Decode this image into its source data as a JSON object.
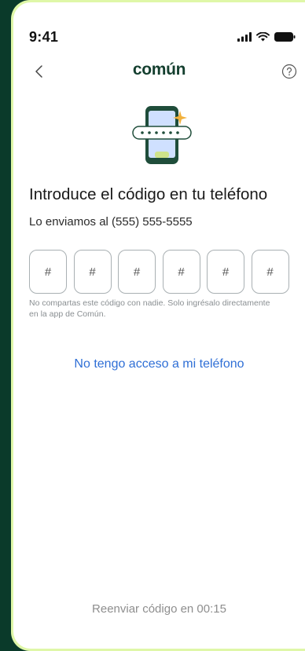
{
  "status_bar": {
    "time": "9:41",
    "icons": [
      "signal-icon",
      "wifi-icon",
      "battery-icon"
    ]
  },
  "nav": {
    "back_icon": "chevron-left-icon",
    "logo": "común",
    "help_icon": "question-circle-icon"
  },
  "illustration": {
    "icon": "phone-code-illustration",
    "colors": {
      "phone": "#1f4d3a",
      "screen": "#cfe0ff",
      "code_bar": "#ffffff",
      "sparkle": "#f2b13c",
      "button": "#cfe38a"
    }
  },
  "content": {
    "title": "Introduce el código en tu teléfono",
    "subtitle": "Lo enviamos al (555) 555-5555",
    "code_fields": [
      "#",
      "#",
      "#",
      "#",
      "#",
      "#"
    ],
    "hint": "No compartas este código con nadie. Solo ingrésalo directamente en la app de Común.",
    "no_access_link": "No tengo acceso a mi teléfono",
    "resend": "Reenviar código en 00:15"
  },
  "colors": {
    "background": "#0a3a2a",
    "frame": "#dff7a8",
    "link": "#2f6fd6",
    "brand": "#143f2f"
  }
}
